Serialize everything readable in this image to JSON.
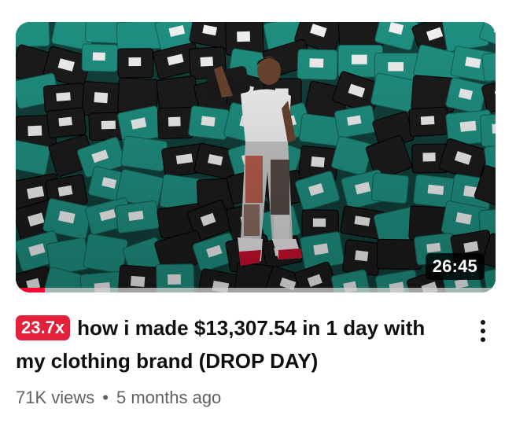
{
  "video": {
    "thumbnail": "person lying on a large pile of teal and black shipping packages",
    "duration": "26:45",
    "watched_fraction": 0.06,
    "badge": "23.7x",
    "title": "how i made $13,307.54 in 1 day with my clothing brand (DROP DAY)",
    "views": "71K views",
    "separator": "•",
    "age": "5 months ago"
  },
  "colors": {
    "badge_bg": "#e4203a",
    "progress": "#ff0033",
    "package_teal": "#1f8f80",
    "package_black": "#1b1b1b"
  },
  "icons": {
    "menu": "more-vertical-icon"
  }
}
